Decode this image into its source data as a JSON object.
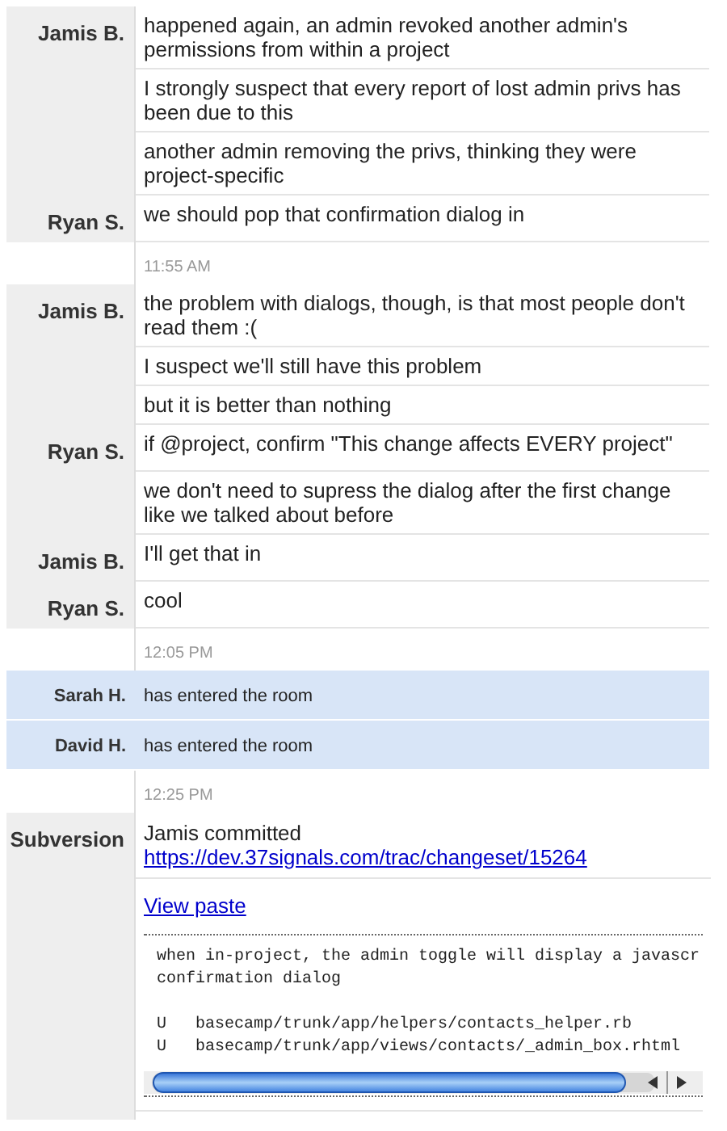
{
  "entries": [
    {
      "kind": "message",
      "speaker": "Jamis B.",
      "text": "happened again, an admin revoked another admin's permissions from within a project"
    },
    {
      "kind": "message",
      "text": "I strongly suspect that every report of lost admin privs has been due to this"
    },
    {
      "kind": "message",
      "text": "another admin removing the privs, thinking they were project-specific"
    },
    {
      "kind": "message",
      "speaker": "Ryan S.",
      "text": "we should pop that confirmation dialog in"
    },
    {
      "kind": "timestamp",
      "text": "11:55 AM"
    },
    {
      "kind": "message",
      "speaker": "Jamis B.",
      "text": "the problem with dialogs, though, is that most people don't read them :("
    },
    {
      "kind": "message",
      "text": "I suspect we'll still have this problem"
    },
    {
      "kind": "message",
      "text": "but it is better than nothing"
    },
    {
      "kind": "message",
      "speaker": "Ryan S.",
      "text": "if @project, confirm \"This change affects EVERY project\""
    },
    {
      "kind": "message",
      "text": "we don't need to supress the dialog after the first change like we talked about before"
    },
    {
      "kind": "message",
      "speaker": "Jamis B.",
      "text": "I'll get that in"
    },
    {
      "kind": "message",
      "speaker": "Ryan S.",
      "text": "cool"
    },
    {
      "kind": "timestamp",
      "text": "12:05 PM"
    },
    {
      "kind": "enter",
      "speaker": "Sarah H.",
      "text": "has entered the room"
    },
    {
      "kind": "enter",
      "speaker": "David H.",
      "text": "has entered the room"
    },
    {
      "kind": "timestamp",
      "text": "12:25 PM"
    },
    {
      "kind": "commit",
      "speaker": "Subversion",
      "text": "Jamis committed",
      "link": "https://dev.37signals.com/trac/changeset/15264",
      "paste_link": "View paste",
      "paste_lines": [
        "when in-project, the admin toggle will display a javascr",
        "confirmation dialog"
      ],
      "files": [
        {
          "status": "U",
          "path": "basecamp/trunk/app/helpers/contacts_helper.rb"
        },
        {
          "status": "U",
          "path": "basecamp/trunk/app/views/contacts/_admin_box.rhtml"
        }
      ]
    }
  ]
}
